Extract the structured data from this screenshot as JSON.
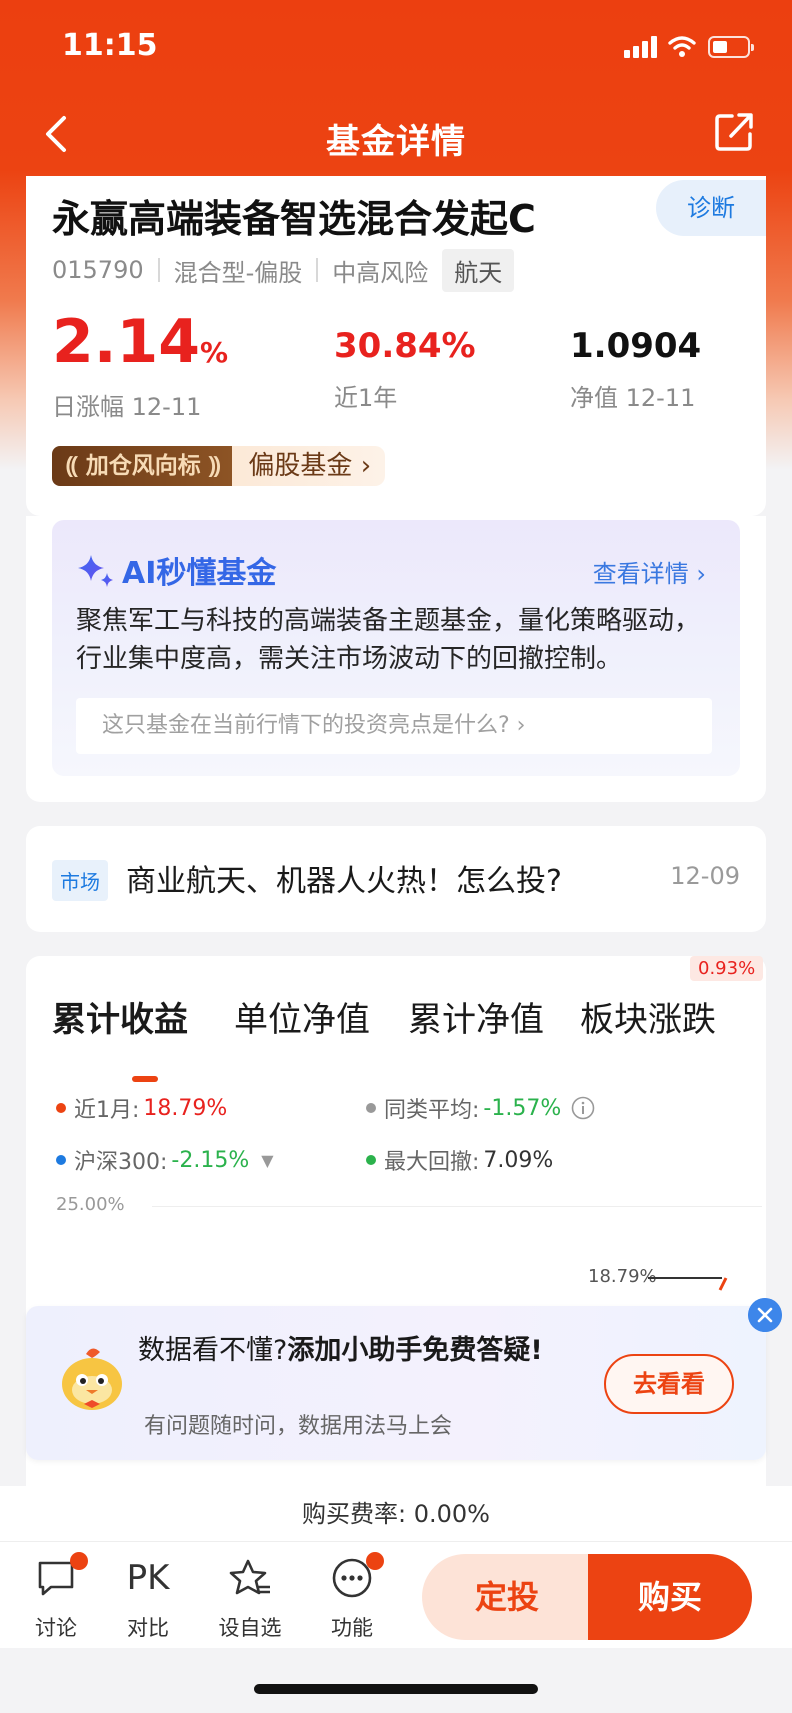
{
  "status": {
    "time": "11:15"
  },
  "nav": {
    "title": "基金详情",
    "back_icon": "chevron-left-icon",
    "share_icon": "share-icon"
  },
  "fund": {
    "name": "永赢高端装备智选混合发起C",
    "diagnose_label": "诊断",
    "code": "015790",
    "type": "混合型-偏股",
    "risk": "中高风险",
    "sector_tag": "航天",
    "daily_change": "2.14",
    "daily_change_unit": "%",
    "daily_change_label": "日涨幅 12-11",
    "year_return": "30.84%",
    "year_return_label": "近1年",
    "nav_value": "1.0904",
    "nav_label": "净值 12-11",
    "promo_badge": "加仓风向标",
    "promo_text": "偏股基金"
  },
  "ai": {
    "title": "AI秒懂基金",
    "more": "查看详情",
    "summary": "聚焦军工与科技的高端装备主题基金，量化策略驱动，行业集中度高，需关注市场波动下的回撤控制。",
    "question": "这只基金在当前行情下的投资亮点是什么?"
  },
  "news": {
    "tag": "市场",
    "title": "商业航天、机器人火热！怎么投?",
    "date": "12-09"
  },
  "performance": {
    "tabs": [
      "累计收益",
      "单位净值",
      "累计净值",
      "板块涨跌"
    ],
    "active_tab": 0,
    "sector_badge": "0.93%",
    "legend": [
      {
        "label": "近1月:",
        "value": "18.79%",
        "dot_color": "#ec4312",
        "value_color": "#e8221e"
      },
      {
        "label": "同类平均:",
        "value": "-1.57%",
        "dot_color": "#999999",
        "value_color": "#2bb24c"
      },
      {
        "label": "沪深300:",
        "value": "-2.15%",
        "dot_color": "#1d7ae0",
        "value_color": "#2bb24c"
      },
      {
        "label": "最大回撤:",
        "value": "7.09%",
        "dot_color": "#2bb24c",
        "value_color": "#333333"
      }
    ],
    "y_top_label": "25.00%",
    "end_label": "18.79%"
  },
  "helper": {
    "title_plain": "数据看不懂?",
    "title_bold": "添加小助手免费答疑!",
    "subtitle": "有问题随时问，数据用法马上会",
    "button": "去看看"
  },
  "fee": {
    "text": "购买费率: 0.00%"
  },
  "bottom": {
    "items": [
      {
        "label": "讨论",
        "icon": "chat-bubble-icon"
      },
      {
        "label": "对比",
        "icon": "pk-icon",
        "glyph": "PK"
      },
      {
        "label": "设自选",
        "icon": "star-icon"
      },
      {
        "label": "功能",
        "icon": "more-dots-icon"
      }
    ],
    "sip_label": "定投",
    "buy_label": "购买"
  },
  "colors": {
    "brand": "#ec4312",
    "up": "#e8221e",
    "down": "#2bb24c",
    "link": "#1d7ae0"
  }
}
